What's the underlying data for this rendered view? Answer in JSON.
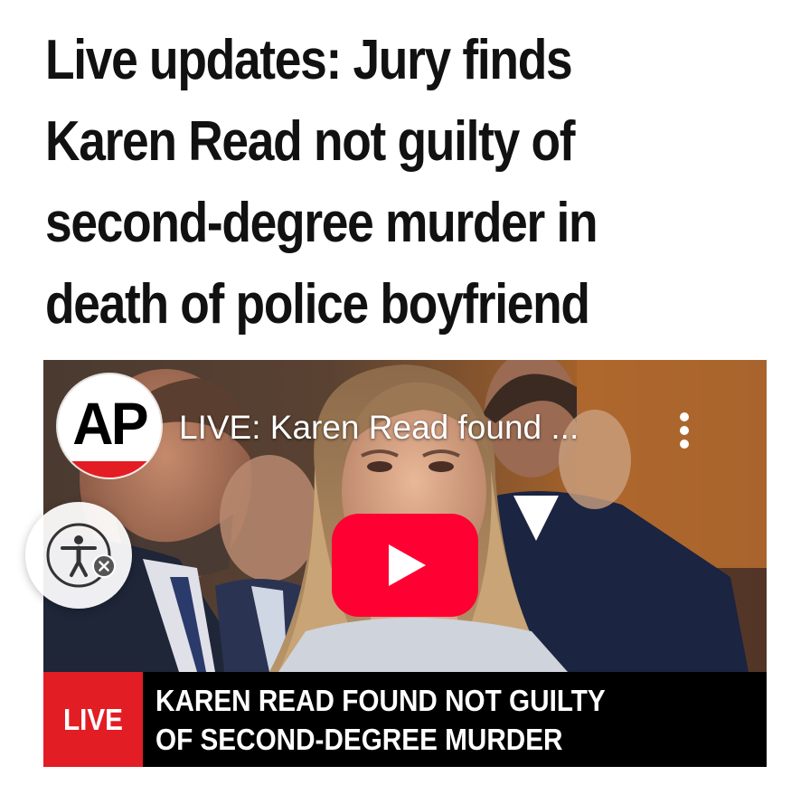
{
  "article": {
    "headline_lines": [
      "Live updates: Jury finds",
      "Karen Read not guilty of",
      "second-degree murder in",
      "death of police boyfriend"
    ]
  },
  "video": {
    "channel_logo_text": "AP",
    "title": "LIVE: Karen Read found ...",
    "more_icon": "more-vertical-icon",
    "play_icon": "youtube-play-icon",
    "live_badge": "LIVE",
    "banner_lines": [
      "KAREN READ FOUND NOT GUILTY",
      "OF SECOND-DEGREE MURDER"
    ]
  },
  "accessibility_widget": {
    "icon": "accessibility-person-icon",
    "close_icon": "close-icon"
  },
  "colors": {
    "live_red": "#e31d24",
    "youtube_red": "#ff0033",
    "banner_black": "#000000",
    "headline_text": "#111111"
  }
}
